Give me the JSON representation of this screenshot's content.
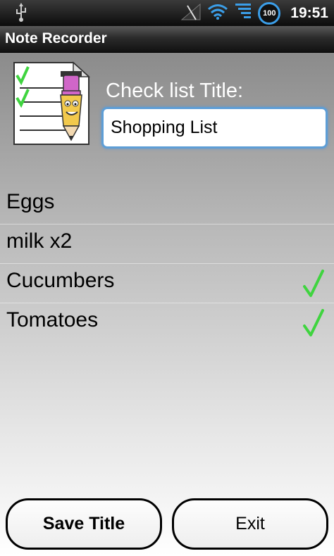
{
  "status_bar": {
    "time": "19:51",
    "battery_level": "100",
    "icons": [
      "usb-icon",
      "signal-off-icon",
      "wifi-icon",
      "data-signal-icon",
      "battery-icon"
    ]
  },
  "app": {
    "title": "Note Recorder"
  },
  "form": {
    "label": "Check list Title:",
    "title_value": "Shopping List"
  },
  "items": [
    {
      "label": "Eggs",
      "checked": false
    },
    {
      "label": "milk x2",
      "checked": false
    },
    {
      "label": "Cucumbers",
      "checked": true
    },
    {
      "label": "Tomatoes",
      "checked": true
    }
  ],
  "buttons": {
    "save": "Save Title",
    "exit": "Exit"
  },
  "colors": {
    "check": "#3fd43f",
    "accent": "#3b9ee8"
  }
}
